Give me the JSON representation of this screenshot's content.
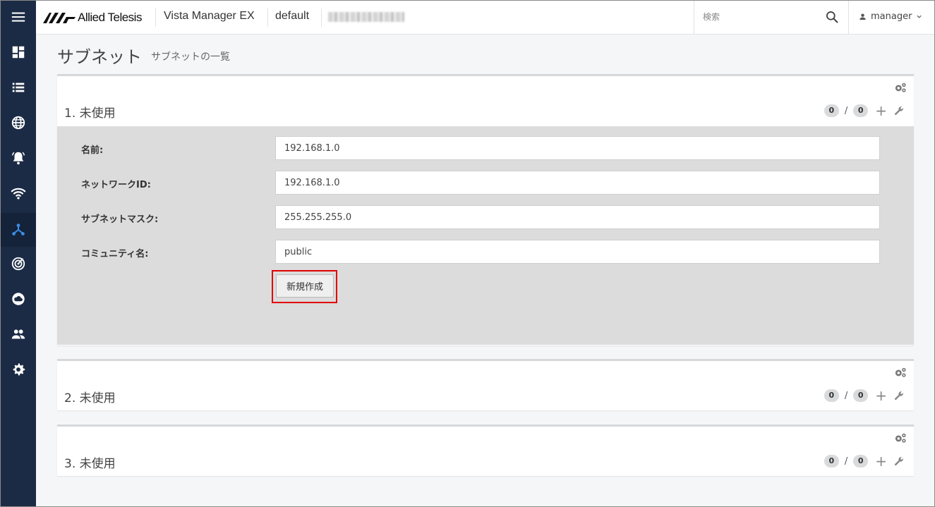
{
  "topbar": {
    "brand": "Allied Telesis",
    "app_name": "Vista Manager EX",
    "context": "default",
    "search_placeholder": "検索",
    "user": "manager"
  },
  "sidebar": {
    "items": [
      {
        "icon": "menu-icon"
      },
      {
        "icon": "dashboard-icon"
      },
      {
        "icon": "list-icon"
      },
      {
        "icon": "globe-icon"
      },
      {
        "icon": "alarm-bell-icon"
      },
      {
        "icon": "wifi-icon"
      },
      {
        "icon": "network-topology-icon",
        "active": true
      },
      {
        "icon": "radar-icon"
      },
      {
        "icon": "cloud-icon"
      },
      {
        "icon": "users-icon"
      },
      {
        "icon": "settings-gear-icon"
      }
    ]
  },
  "page": {
    "title": "サブネット",
    "subtitle": "サブネットの一覧"
  },
  "panels": [
    {
      "title": "1. 未使用",
      "count_a": "0",
      "slash": "/",
      "count_b": "0",
      "expanded": true,
      "form": {
        "name_label": "名前:",
        "name_value": "192.168.1.0",
        "network_label": "ネットワークID:",
        "network_value": "192.168.1.0",
        "mask_label": "サブネットマスク:",
        "mask_value": "255.255.255.0",
        "community_label": "コミュニティ名:",
        "community_value": "public",
        "create_button": "新規作成"
      }
    },
    {
      "title": "2. 未使用",
      "count_a": "0",
      "slash": "/",
      "count_b": "0",
      "expanded": false
    },
    {
      "title": "3. 未使用",
      "count_a": "0",
      "slash": "/",
      "count_b": "0",
      "expanded": false
    }
  ],
  "colors": {
    "sidebar_bg": "#1c2b45",
    "sidebar_icon": "#ffffff",
    "active_icon": "#3a8ee6",
    "highlight": "#e00000"
  }
}
